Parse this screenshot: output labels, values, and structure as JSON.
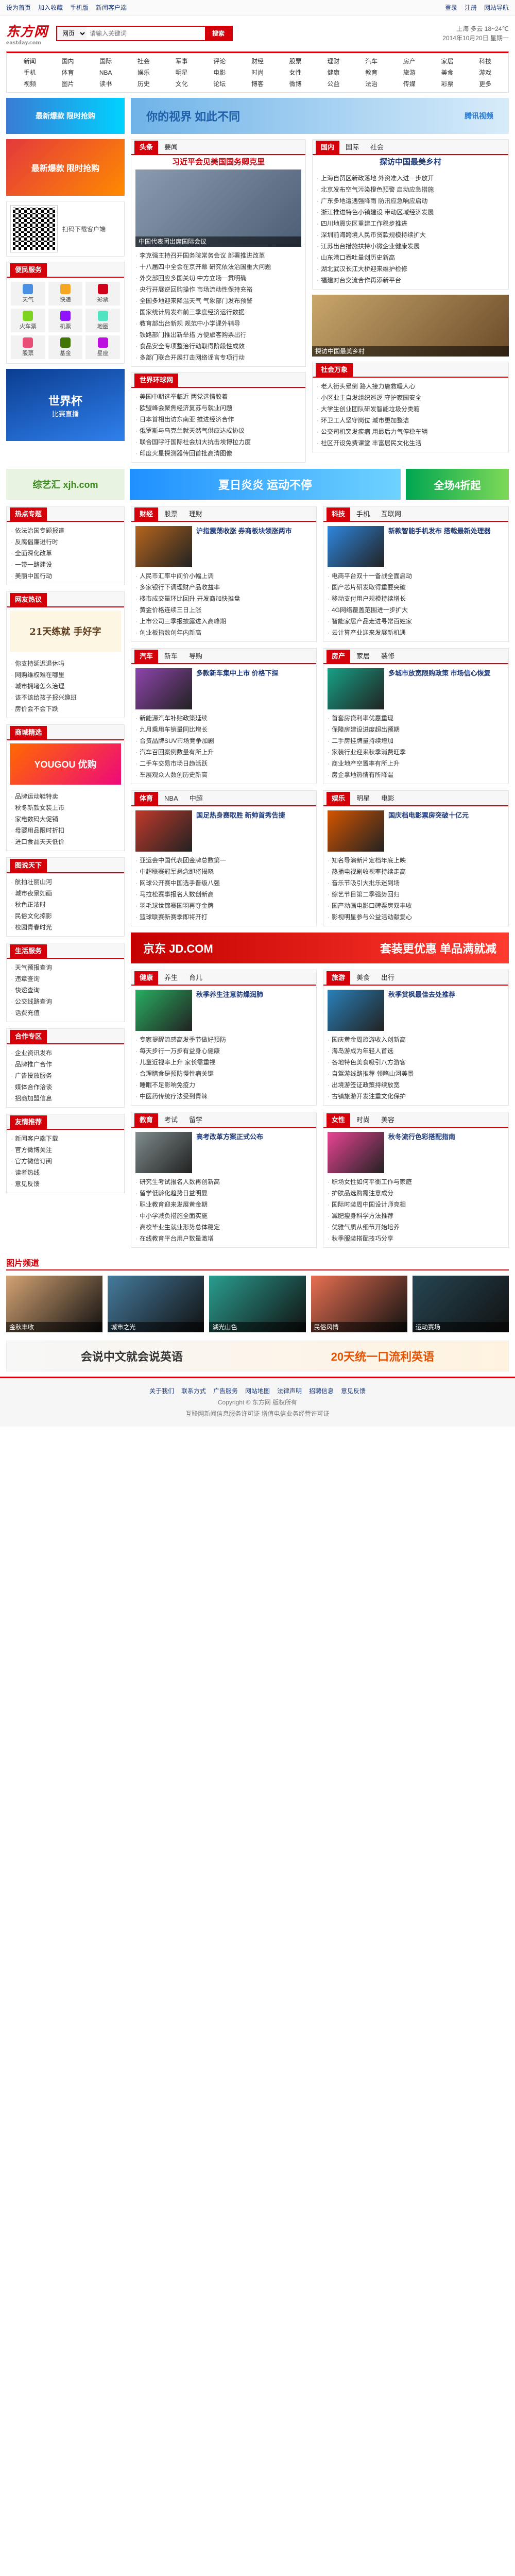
{
  "topbar": {
    "items": [
      "设为首页",
      "加入收藏",
      "手机版",
      "新闻客户端"
    ],
    "right": [
      "登录",
      "注册",
      "网站导航"
    ]
  },
  "header": {
    "logo": "东方网",
    "logo_sub": "eastday.com",
    "search_scope": "网页",
    "search_placeholder": "请输入关键词",
    "search_button": "搜索",
    "weather_line1": "上海 多云 18~24℃",
    "weather_line2": "2014年10月20日 星期一"
  },
  "nav": [
    "新闻",
    "国内",
    "国际",
    "社会",
    "军事",
    "评论",
    "财经",
    "股票",
    "理财",
    "汽车",
    "房产",
    "家居",
    "科技",
    "手机",
    "体育",
    "NBA",
    "娱乐",
    "明星",
    "电影",
    "时尚",
    "女性",
    "健康",
    "教育",
    "旅游",
    "美食",
    "游戏",
    "视频",
    "图片",
    "读书",
    "历史",
    "文化",
    "论坛",
    "博客",
    "微博",
    "公益",
    "法治",
    "传媒",
    "彩票",
    "更多"
  ],
  "banner_ad": {
    "text": "你的视界 如此不同",
    "brand": "腾讯视频"
  },
  "left": {
    "promo1": "最新爆款 限时抢购",
    "promo2": "扫码下载客户端",
    "tools_title": "便民服务",
    "tools": [
      "天气",
      "快递",
      "彩票",
      "火车票",
      "机票",
      "地图",
      "股票",
      "基金",
      "星座"
    ],
    "ad_title": "世界杯",
    "ad_sub": "比赛直播"
  },
  "focus": {
    "tabs": [
      "头条",
      "要闻"
    ],
    "headline": "习近平会见美国国务卿克里",
    "caption": "中国代表团出席国际会议",
    "news": [
      "李克强主持召开国务院常务会议 部署推进改革",
      "十八届四中全会在京开幕 研究依法治国重大问题",
      "外交部回应多国关切 中方立场一贯明确",
      "央行开展逆回购操作 市场流动性保持充裕",
      "全国多地迎来降温天气 气象部门发布预警",
      "国家统计局发布前三季度经济运行数据",
      "教育部出台新规 规范中小学课外辅导",
      "铁路部门推出新举措 方便旅客购票出行",
      "食品安全专项整治行动取得阶段性成效",
      "多部门联合开展打击网络谣言专项行动"
    ]
  },
  "right": {
    "tabs": [
      "国内",
      "国际",
      "社会"
    ],
    "headline": "探访中国最美乡村",
    "news": [
      "上海自贸区新政落地 外资准入进一步放开",
      "北京发布空气污染橙色预警 启动应急措施",
      "广东多地遭遇强降雨 防汛应急响应启动",
      "浙江推进特色小镇建设 带动区域经济发展",
      "四川地震灾区重建工作稳步推进",
      "深圳前海跨境人民币贷款规模持续扩大",
      "江苏出台措施扶持小微企业健康发展",
      "山东港口吞吐量创历史新高",
      "湖北武汉长江大桥迎来维护检修",
      "福建对台交流合作再添新平台"
    ]
  },
  "world": {
    "title": "世界环球网",
    "news": [
      "美国中期选举临近 两党选情胶着",
      "欧盟峰会聚焦经济复苏与就业问题",
      "日本首相出访东南亚 推进经济合作",
      "俄罗斯与乌克兰就天然气供应达成协议",
      "联合国呼吁国际社会加大抗击埃博拉力度",
      "印度火星探测器传回首批高清图像"
    ]
  },
  "lifestyle": {
    "title": "社会万象",
    "news": [
      "老人街头晕倒 路人接力施救暖人心",
      "小区业主自发组织巡逻 守护家园安全",
      "大学生创业团队研发智能垃圾分类箱",
      "环卫工人坚守岗位 城市更加整洁",
      "公交司机突发疾病 用最后力气停稳车辆",
      "社区开设免费课堂 丰富居民文化生活"
    ]
  },
  "mid_ad": {
    "text": "综艺汇 xjh.com",
    "text2": "夏日炎炎 运动不停",
    "text3": "全场4折起"
  },
  "channels": [
    {
      "name": "财经",
      "tabs": [
        "财经",
        "股票",
        "理财"
      ],
      "news": [
        "沪指震荡收涨 券商板块领涨两市",
        "人民币汇率中间价小幅上调",
        "多家银行下调理财产品收益率",
        "楼市成交量环比回升 开发商加快推盘",
        "黄金价格连续三日上涨",
        "上市公司三季报披露进入高峰期",
        "创业板指数创年内新高"
      ]
    },
    {
      "name": "科技",
      "tabs": [
        "科技",
        "手机",
        "互联网"
      ],
      "news": [
        "新款智能手机发布 搭载最新处理器",
        "电商平台双十一备战全面启动",
        "国产芯片研发取得重要突破",
        "移动支付用户规模持续增长",
        "4G网络覆盖范围进一步扩大",
        "智能家居产品走进寻常百姓家",
        "云计算产业迎来发展新机遇"
      ]
    },
    {
      "name": "汽车",
      "tabs": [
        "汽车",
        "新车",
        "导购"
      ],
      "news": [
        "多款新车集中上市 价格下探",
        "新能源汽车补贴政策延续",
        "九月乘用车销量同比增长",
        "合资品牌SUV市场竞争加剧",
        "汽车召回案例数量有所上升",
        "二手车交易市场日趋活跃",
        "车展观众人数创历史新高"
      ]
    },
    {
      "name": "房产",
      "tabs": [
        "房产",
        "家居",
        "装修"
      ],
      "news": [
        "多城市放宽限购政策 市场信心恢复",
        "首套房贷利率优惠重现",
        "保障房建设进度超出预期",
        "二手房挂牌量持续增加",
        "家装行业迎来秋季消费旺季",
        "商业地产空置率有所上升",
        "房企拿地热情有所降温"
      ]
    },
    {
      "name": "体育",
      "tabs": [
        "体育",
        "NBA",
        "中超"
      ],
      "news": [
        "国足热身赛取胜 新帅首秀告捷",
        "亚运会中国代表团金牌总数第一",
        "中超联赛冠军悬念即将揭晓",
        "网球公开赛中国选手晋级八强",
        "马拉松赛事报名人数创新高",
        "羽毛球世锦赛国羽再夺金牌",
        "篮球联赛新赛季即将开打"
      ]
    },
    {
      "name": "娱乐",
      "tabs": [
        "娱乐",
        "明星",
        "电影"
      ],
      "news": [
        "国庆档电影票房突破十亿元",
        "知名导演新片定档年底上映",
        "热播电视剧收视率持续走高",
        "音乐节吸引大批乐迷到场",
        "综艺节目第二季强势回归",
        "国产动画电影口碑票房双丰收",
        "影视明星参与公益活动献爱心"
      ]
    },
    {
      "name": "健康",
      "tabs": [
        "健康",
        "养生",
        "育儿"
      ],
      "news": [
        "秋季养生注意防燥润肺",
        "专家提醒流感高发季节做好预防",
        "每天步行一万步有益身心健康",
        "儿童近视率上升 家长需重视",
        "合理膳食是预防慢性病关键",
        "睡眠不足影响免疫力",
        "中医药传统疗法受到青睐"
      ]
    },
    {
      "name": "旅游",
      "tabs": [
        "旅游",
        "美食",
        "出行"
      ],
      "news": [
        "秋季赏枫最佳去处推荐",
        "国庆黄金周旅游收入创新高",
        "海岛游成为年轻人首选",
        "各地特色美食吸引八方游客",
        "自驾游线路推荐 领略山河美景",
        "出境游签证政策持续放宽",
        "古镇旅游开发注重文化保护"
      ]
    },
    {
      "name": "教育",
      "tabs": [
        "教育",
        "考试",
        "留学"
      ],
      "news": [
        "高考改革方案正式公布",
        "研究生考试报名人数再创新高",
        "留学低龄化趋势日益明显",
        "职业教育迎来发展黄金期",
        "中小学减负措施全面实施",
        "高校毕业生就业形势总体稳定",
        "在线教育平台用户数量激增"
      ]
    },
    {
      "name": "女性",
      "tabs": [
        "女性",
        "时尚",
        "美容"
      ],
      "news": [
        "秋冬流行色彩搭配指南",
        "职场女性如何平衡工作与家庭",
        "护肤品选购需注意成分",
        "国际时装周中国设计师亮相",
        "减肥瘦身科学方法推荐",
        "优雅气质从细节开始培养",
        "秋季服装搭配技巧分享"
      ]
    }
  ],
  "jd_ad": {
    "brand": "京东 JD.COM",
    "text": "套装更优惠 单品满就减"
  },
  "left_modules": [
    {
      "title": "热点专题",
      "items": [
        "依法治国专题报道",
        "反腐倡廉进行时",
        "全面深化改革",
        "一带一路建设",
        "美丽中国行动"
      ]
    },
    {
      "title": "网友热议",
      "items": [
        "你支持延迟退休吗",
        "网购维权难在哪里",
        "城市拥堵怎么治理",
        "该不该给孩子报兴趣班",
        "房价会不会下跌"
      ]
    },
    {
      "title": "商城精选",
      "items": [
        "品牌运动鞋特卖",
        "秋冬新款女装上市",
        "家电数码大促销",
        "母婴用品限时折扣",
        "进口食品天天低价"
      ]
    },
    {
      "title": "图说天下",
      "items": [
        "航拍壮丽山河",
        "城市夜景如画",
        "秋色正浓时",
        "民俗文化掠影",
        "校园青春时光"
      ]
    },
    {
      "title": "生活服务",
      "items": [
        "天气预报查询",
        "违章查询",
        "快递查询",
        "公交线路查询",
        "话费充值"
      ]
    },
    {
      "title": "合作专区",
      "items": [
        "企业资讯发布",
        "品牌推广合作",
        "广告投放服务",
        "媒体合作洽谈",
        "招商加盟信息"
      ]
    },
    {
      "title": "友情推荐",
      "items": [
        "新闻客户端下载",
        "官方微博关注",
        "官方微信订阅",
        "读者热线",
        "意见反馈"
      ]
    }
  ],
  "side_ad1": {
    "text": "21天练就 手好字"
  },
  "side_ad2": {
    "text": "YOUGOU 优购"
  },
  "photos": {
    "title": "图片频道",
    "captions": [
      "金秋丰收",
      "城市之光",
      "湖光山色",
      "民俗风情",
      "运动赛场"
    ]
  },
  "bottom_ad": {
    "text": "会说中文就会说英语",
    "sub": "20天统一口流利英语"
  },
  "footer": {
    "links": [
      "关于我们",
      "联系方式",
      "广告服务",
      "网站地图",
      "法律声明",
      "招聘信息",
      "意见反馈"
    ],
    "copyright": "Copyright © 东方网 版权所有",
    "license": "互联网新闻信息服务许可证 增值电信业务经营许可证"
  }
}
